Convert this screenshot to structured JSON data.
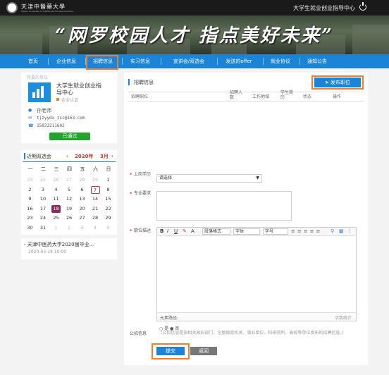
{
  "header": {
    "logo_text": "天津中醫藥大學",
    "logo_sub": "Tianjin University of Traditional Chinese Medicine",
    "center_name": "大学生就业创业指导中心",
    "banner": "“网罗校园人才  指点美好未来”"
  },
  "nav": {
    "items": [
      "首页",
      "企业信息",
      "招聘信息",
      "实习信息",
      "宣讲会/双选会",
      "发送的offer",
      "就业协议",
      "通知公告"
    ]
  },
  "company": {
    "section_title": "我要的单位",
    "name": "大学生就业创业指导中心",
    "certified": "企业认证",
    "contact": "孙老师",
    "email": "tjzyydx_zsc@163.com",
    "phone": "15022211602",
    "status": "已通过"
  },
  "calendar": {
    "title": "近期双选会",
    "year": "2020年",
    "month": "3月",
    "weekdays": [
      "一",
      "二",
      "三",
      "四",
      "五",
      "六",
      "日"
    ],
    "weeks": [
      [
        "24",
        "25",
        "26",
        "27",
        "28",
        "29",
        "1"
      ],
      [
        "2",
        "3",
        "4",
        "5",
        "6",
        "7",
        "8"
      ],
      [
        "9",
        "10",
        "11",
        "12",
        "13",
        "14",
        "15"
      ],
      [
        "16",
        "17",
        "18",
        "19",
        "20",
        "21",
        "22"
      ],
      [
        "23",
        "24",
        "25",
        "26",
        "27",
        "28",
        "29"
      ],
      [
        "30",
        "31",
        "1",
        "2",
        "3",
        "4",
        "5"
      ]
    ],
    "today": "7",
    "selected": "18"
  },
  "news": {
    "item": "天津中医药大学2020届毕业...",
    "date": "2020-03-18 10:00"
  },
  "job_list": {
    "title": "招聘信息",
    "publish_button": "发布职位",
    "columns": [
      "招聘职位",
      "招聘人数",
      "工作地域",
      "学生简历",
      "状态",
      "操作"
    ]
  },
  "form": {
    "required_mark": "*",
    "position_label": "上岗学历",
    "position_select": "请选择",
    "requirements_label": "专业要求",
    "description_label": "职位描述",
    "editor_tools": [
      "B",
      "I",
      "U",
      "A",
      "段落格式",
      "字体",
      "字号"
    ],
    "editor_path": "元素路径:",
    "word_count": "字数统计",
    "public_label": "公招信息",
    "radio_yes": "是",
    "radio_no": "否",
    "public_note": "(公招信息是指相关政府部门、全额拨款机关、事业单位、科研院所、高校等单位发布的招聘信息。)",
    "submit": "提交",
    "back": "返回"
  },
  "colors": {
    "nav": "#1b84d6",
    "accent": "#ef7f2e",
    "green": "#22a32c",
    "red": "#c0392b"
  }
}
